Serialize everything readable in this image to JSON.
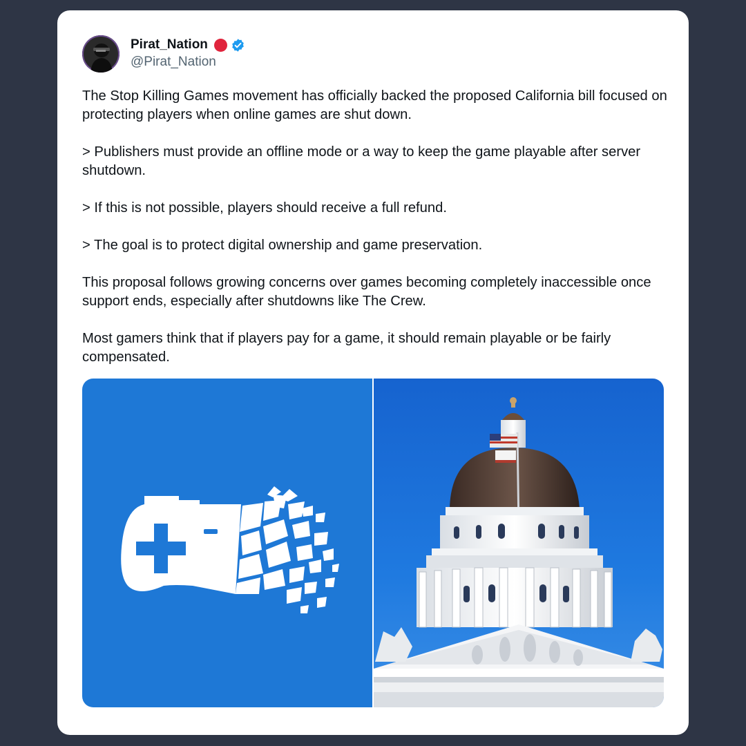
{
  "post": {
    "author": {
      "display_name": "Pirat_Nation",
      "handle": "@Pirat_Nation",
      "verified": true,
      "status_dot_color": "#e0243c",
      "verified_color": "#1d9bf0"
    },
    "paragraphs": [
      "The Stop Killing Games movement has officially backed the proposed California bill focused on protecting players when online games are shut down.",
      "> Publishers must provide an offline mode or a way to keep the game playable after server shutdown.",
      "> If this is not possible, players should receive a full refund.",
      "> The goal is to protect digital ownership and game preservation.",
      "This proposal follows growing concerns over games becoming completely inaccessible once support ends, especially after shutdowns like The Crew.",
      "Most gamers think that if players pay for a game, it should remain playable or be fairly compensated."
    ],
    "media": {
      "left_image": "shattered-game-controller-icon",
      "right_image": "california-capitol-dome-photo",
      "left_bg_color": "#1e78d6"
    }
  },
  "colors": {
    "page_background": "#2e3545",
    "card_background": "#ffffff",
    "text_primary": "#0f1419",
    "text_secondary": "#536471"
  }
}
